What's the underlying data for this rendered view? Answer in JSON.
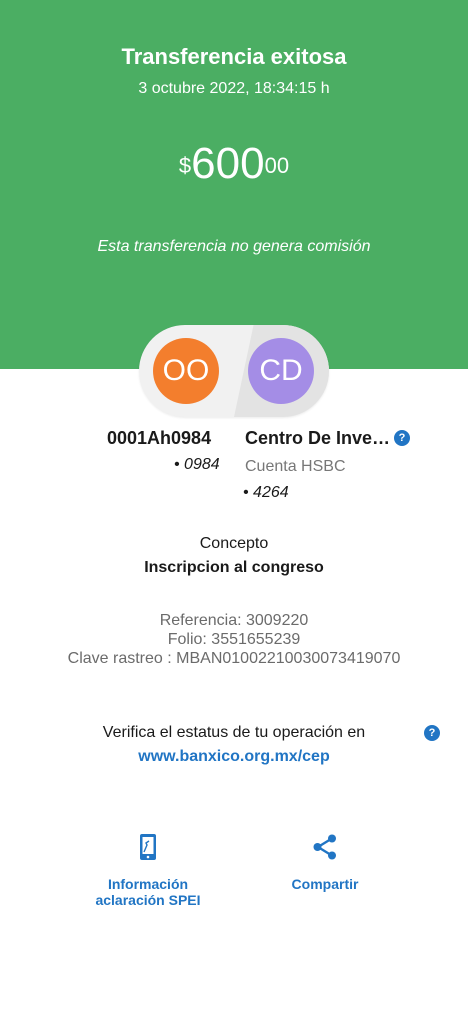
{
  "header": {
    "title": "Transferencia exitosa",
    "datetime": "3 octubre 2022, 18:34:15 h",
    "amount_currency": "$",
    "amount_whole": "600",
    "amount_cents": "00",
    "fee_note": "Esta transferencia no genera comisión",
    "background_color": "#4bae63"
  },
  "from_account": {
    "initials": "OO",
    "name": "0001Ah0984",
    "number": "• 0984",
    "avatar_color": "#f37e2d"
  },
  "to_account": {
    "initials": "CD",
    "name": "Centro De Inves...",
    "bank": "Cuenta HSBC",
    "number": "• 4264",
    "avatar_color": "#a48de6",
    "help_icon": "question-icon"
  },
  "concept": {
    "label": "Concepto",
    "value": "Inscripcion al congreso"
  },
  "references": {
    "referencia": "Referencia: 3009220",
    "folio": "Folio: 3551655239",
    "clave_rastreo": "Clave rastreo : MBAN01002210030073419070"
  },
  "verify": {
    "text": "Verifica el estatus de tu operación en",
    "link": "www.banxico.org.mx/cep",
    "help_icon": "question-icon"
  },
  "actions": [
    {
      "label_line1": "Información",
      "label_line2": "aclaración SPEI",
      "icon": "phone-icon"
    },
    {
      "label": "Compartir",
      "icon": "share-icon"
    }
  ],
  "accent_color": "#2175c4"
}
